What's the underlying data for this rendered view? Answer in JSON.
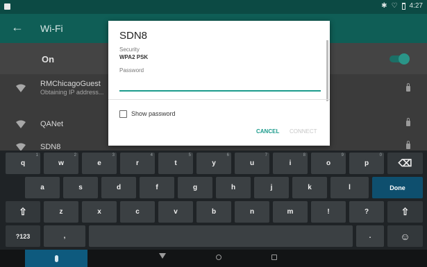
{
  "status_bar": {
    "time": "4:27"
  },
  "app_bar": {
    "back_glyph": "←",
    "title": "Wi-Fi"
  },
  "wifi_toggle": {
    "label": "On",
    "state": "on"
  },
  "networks": [
    {
      "name": "RMChicagoGuest",
      "status": "Obtaining IP address...",
      "secured": true
    },
    {
      "name": "QANet",
      "status": "",
      "secured": true
    },
    {
      "name": "SDN8",
      "status": "",
      "secured": true
    }
  ],
  "dialog": {
    "title": "SDN8",
    "security_label": "Security",
    "security_value": "WPA2 PSK",
    "password_label": "Password",
    "password_value": "",
    "show_password_label": "Show password",
    "show_password_checked": false,
    "cancel_label": "CANCEL",
    "connect_label": "CONNECT"
  },
  "keyboard": {
    "row1": [
      {
        "label": "q",
        "hint": "1"
      },
      {
        "label": "w",
        "hint": "2"
      },
      {
        "label": "e",
        "hint": "3"
      },
      {
        "label": "r",
        "hint": "4"
      },
      {
        "label": "t",
        "hint": "5"
      },
      {
        "label": "y",
        "hint": "6"
      },
      {
        "label": "u",
        "hint": "7"
      },
      {
        "label": "i",
        "hint": "8"
      },
      {
        "label": "o",
        "hint": "9"
      },
      {
        "label": "p",
        "hint": "0"
      }
    ],
    "row2": [
      "a",
      "s",
      "d",
      "f",
      "g",
      "h",
      "j",
      "k",
      "l"
    ],
    "row3": [
      "z",
      "x",
      "c",
      "v",
      "b",
      "n",
      "m",
      "!",
      "?"
    ],
    "shift_glyph": "⇧",
    "backspace_glyph": "⌫",
    "done_label": "Done",
    "symbols_label": "?123",
    "comma_label": ",",
    "period_label": ".",
    "emoji_glyph": "☺"
  },
  "colors": {
    "accent": "#1c9b8c",
    "status_bar": "#0c4a44",
    "app_bar": "#0f5e56",
    "keyboard_bg": "#1f2326",
    "key": "#3b4043",
    "done_key": "#0e4f6e"
  }
}
